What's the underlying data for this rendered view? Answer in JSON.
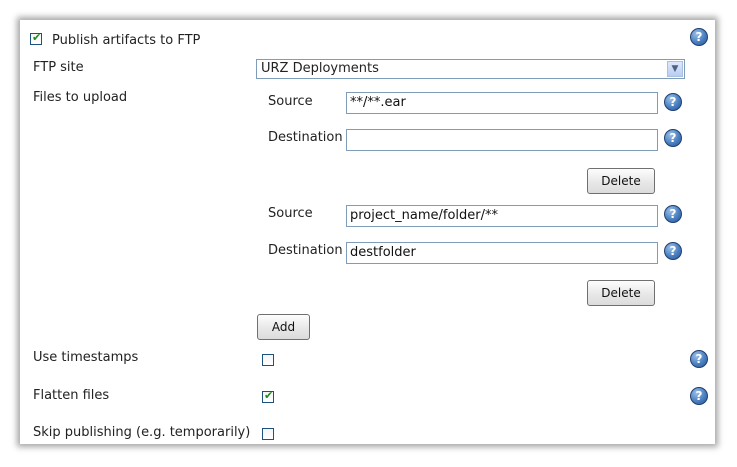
{
  "publish": {
    "label": "Publish artifacts to FTP",
    "checked": true
  },
  "help_glyph": "?",
  "ftp_site": {
    "label": "FTP site",
    "value": "URZ Deployments",
    "arrow": "▼"
  },
  "files": {
    "label": "Files to upload",
    "source_label": "Source",
    "destination_label": "Destination",
    "delete_label": "Delete",
    "entries": [
      {
        "source": "**/**.ear",
        "destination": ""
      },
      {
        "source": "project_name/folder/**",
        "destination": "destfolder"
      }
    ],
    "add_label": "Add"
  },
  "options": {
    "use_timestamps": {
      "label": "Use timestamps",
      "checked": false
    },
    "flatten_files": {
      "label": "Flatten files",
      "checked": true
    },
    "skip_publishing": {
      "label": "Skip publishing (e.g. temporarily)",
      "checked": false
    }
  },
  "check_mark": "✔",
  "colors": {
    "help": "#3d6fb0",
    "check": "#1e8b1e",
    "input_border": "#7f9db9"
  }
}
